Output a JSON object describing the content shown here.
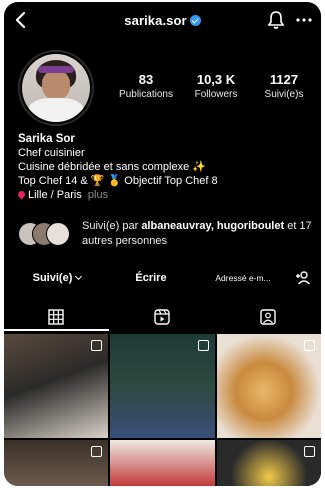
{
  "header": {
    "username": "sarika.sor",
    "back_icon": "chevron-left-icon",
    "notifications_icon": "bell-icon",
    "more_icon": "more-horizontal-icon"
  },
  "stats": [
    {
      "value": "83",
      "label": "Publications"
    },
    {
      "value": "10,3 K",
      "label": "Followers"
    },
    {
      "value": "1127",
      "label": "Suivi(e)s"
    }
  ],
  "bio": {
    "name": "Sarika Sor",
    "category": "Chef cuisinier",
    "line1": "Cuisine débridée et sans complexe ✨",
    "line2": "Top Chef 14 & 🏆 🥇 Objectif Top Chef 8",
    "location": "Lille / Paris",
    "more": "plus"
  },
  "mutual": {
    "prefix": "Suivi(e) par",
    "names": "albaneauvray, hugoriboulet",
    "suffix": "et 17 autres personnes"
  },
  "actions": {
    "follow": "Suivi(e)",
    "message": "Écrire",
    "email": "Adressé e-m...",
    "add_user_icon": "add-user-icon"
  },
  "tabs": [
    "grid-icon",
    "reels-icon",
    "tagged-icon"
  ],
  "colors": {
    "background": "#000000",
    "text": "#ffffff",
    "verified": "#3897f0",
    "secondary": "#8e8e8e"
  }
}
